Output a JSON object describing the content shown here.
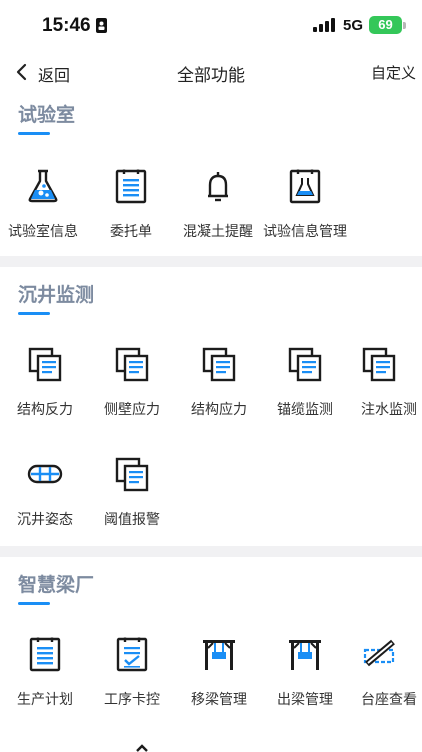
{
  "status": {
    "time": "15:46",
    "network": "5G",
    "battery": "69"
  },
  "nav": {
    "back_label": "返回",
    "title": "全部功能",
    "action_label": "自定义"
  },
  "sections": [
    {
      "title": "试验室",
      "items": [
        {
          "label": "试验室信息",
          "icon": "flask-icon"
        },
        {
          "label": "委托单",
          "icon": "clipboard-list-icon"
        },
        {
          "label": "混凝土提醒",
          "icon": "bell-icon"
        },
        {
          "label": "试验信息管理",
          "icon": "flask-clipboard-icon"
        }
      ]
    },
    {
      "title": "沉井监测",
      "items": [
        {
          "label": "结构反力",
          "icon": "documents-icon"
        },
        {
          "label": "侧壁应力",
          "icon": "documents-icon"
        },
        {
          "label": "结构应力",
          "icon": "documents-icon"
        },
        {
          "label": "锚缆监测",
          "icon": "documents-icon"
        },
        {
          "label": "注水监测",
          "icon": "documents-icon"
        },
        {
          "label": "沉井姿态",
          "icon": "caisson-icon"
        },
        {
          "label": "阈值报警",
          "icon": "documents-icon"
        }
      ]
    },
    {
      "title": "智慧梁厂",
      "items": [
        {
          "label": "生产计划",
          "icon": "clipboard-list-icon"
        },
        {
          "label": "工序卡控",
          "icon": "clipboard-check-icon"
        },
        {
          "label": "移梁管理",
          "icon": "gantry-icon"
        },
        {
          "label": "出梁管理",
          "icon": "gantry-icon"
        },
        {
          "label": "台座查看",
          "icon": "pedestal-icon"
        }
      ]
    }
  ],
  "colors": {
    "accent": "#1a8ef5",
    "icon_dark": "#1c1c1c",
    "section_title": "#7d8ba0"
  }
}
